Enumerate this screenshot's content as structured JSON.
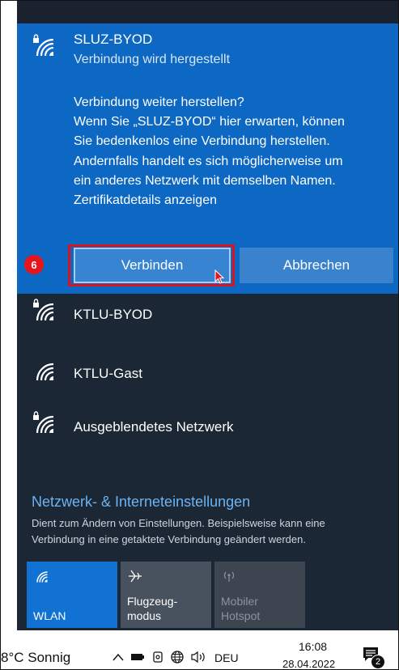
{
  "selected_network": {
    "ssid": "SLUZ-BYOD",
    "status": "Verbindung wird hergestellt",
    "prompt_lines": [
      "Verbindung weiter herstellen?",
      "Wenn Sie „SLUZ-BYOD“ hier erwarten, können",
      "Sie bedenkenlos eine Verbindung herstellen.",
      "Andernfalls handelt es sich möglicherweise um",
      "ein anderes Netzwerk mit demselben Namen.",
      "Zertifikatdetails anzeigen"
    ],
    "connect_label": "Verbinden",
    "cancel_label": "Abbrechen"
  },
  "step_marker": "6",
  "networks": [
    {
      "ssid": "KTLU-BYOD",
      "secured": true
    },
    {
      "ssid": "KTLU-Gast",
      "secured": false
    },
    {
      "ssid": "Ausgeblendetes Netzwerk",
      "secured": true
    }
  ],
  "settings": {
    "title": "Netzwerk- & Interneteinstellungen",
    "desc_lines": [
      "Dient zum Ändern von Einstellungen. Beispielsweise kann eine",
      "Verbindung in eine getaktete Verbindung geändert werden."
    ]
  },
  "quick_actions": {
    "wlan": "WLAN",
    "flight_line1": "Flugzeug-",
    "flight_line2": "modus",
    "hotspot_line1": "Mobiler",
    "hotspot_line2": "Hotspot"
  },
  "taskbar": {
    "weather": "8°C Sonnig",
    "language": "DEU",
    "time": "16:08",
    "date": "28.04.2022",
    "notification_count": "2"
  },
  "colors": {
    "selected_bg": "#0d68c4",
    "panel_bg": "#1b2734",
    "accent_link": "#6db3f2",
    "highlight": "#d8141c"
  }
}
